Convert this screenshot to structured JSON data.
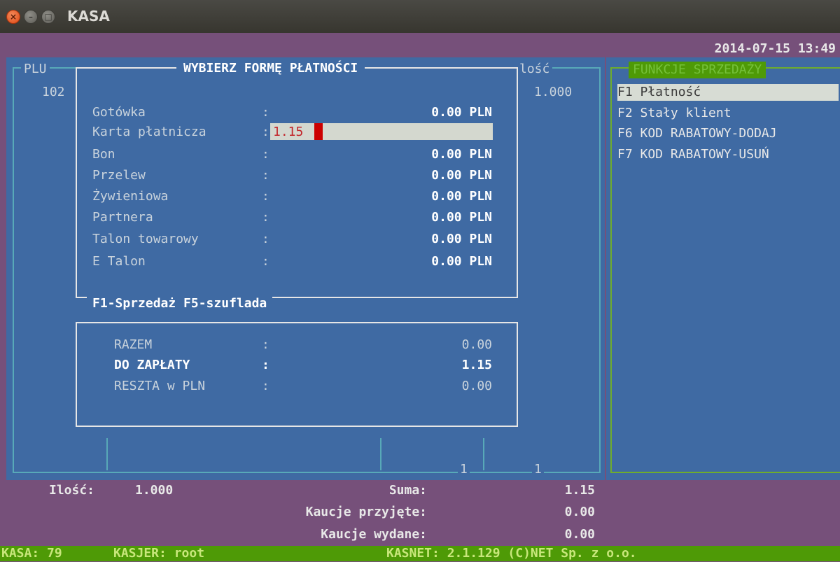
{
  "window": {
    "title": "KASA"
  },
  "header": {
    "datetime": "2014-07-15 13:49"
  },
  "plu_table": {
    "col_plu": "PLU",
    "col_ilosc": "lość",
    "row_plu": "102",
    "row_qty": "1.000",
    "footer_count1": "1",
    "footer_count2": "1"
  },
  "payment_dialog": {
    "title": "WYBIERZ FORMĘ PŁATNOŚCI",
    "colon": ":",
    "rows": [
      {
        "label": "Gotówka",
        "value": "0.00 PLN"
      },
      {
        "label": "Karta płatnicza",
        "value": "1.15"
      },
      {
        "label": "Bon",
        "value": "0.00 PLN"
      },
      {
        "label": "Przelew",
        "value": "0.00 PLN"
      },
      {
        "label": "Żywieniowa",
        "value": "0.00 PLN"
      },
      {
        "label": "Partnera",
        "value": "0.00 PLN"
      },
      {
        "label": "Talon towarowy",
        "value": "0.00 PLN"
      },
      {
        "label": "E Talon",
        "value": "0.00 PLN"
      }
    ],
    "footer": "F1-Sprzedaż F5-szuflada"
  },
  "summary": {
    "razem_label": "RAZEM",
    "razem_value": "0.00",
    "do_zaplaty_label": "DO ZAPŁATY",
    "do_zaplaty_value": "1.15",
    "reszta_label": "RESZTA w PLN",
    "reszta_value": "0.00"
  },
  "functions": {
    "title": "FUNKCJE SPRZEDAŻY",
    "items": [
      "F1 Płatność",
      "F2 Stały klient",
      "F6 KOD RABATOWY-DODAJ",
      "F7 KOD RABATOWY-USUŃ"
    ]
  },
  "totals": {
    "ilosc_label": "Ilość:",
    "ilosc_value": "1.000",
    "suma_label": "Suma:",
    "suma_value": "1.15",
    "kaucje_przyjete_label": "Kaucje przyjęte:",
    "kaucje_przyjete_value": "0.00",
    "kaucje_wydane_label": "Kaucje wydane:",
    "kaucje_wydane_value": "0.00"
  },
  "status": {
    "kasa": "KASA: 79",
    "kasjer": "KASJER: root",
    "version": "KASNET: 2.1.129 (C)NET Sp. z o.o."
  },
  "colors": {
    "blue": "#3f6aa3",
    "purple": "#76507a",
    "green": "#4e9a06",
    "cursor": "#cc0000"
  }
}
